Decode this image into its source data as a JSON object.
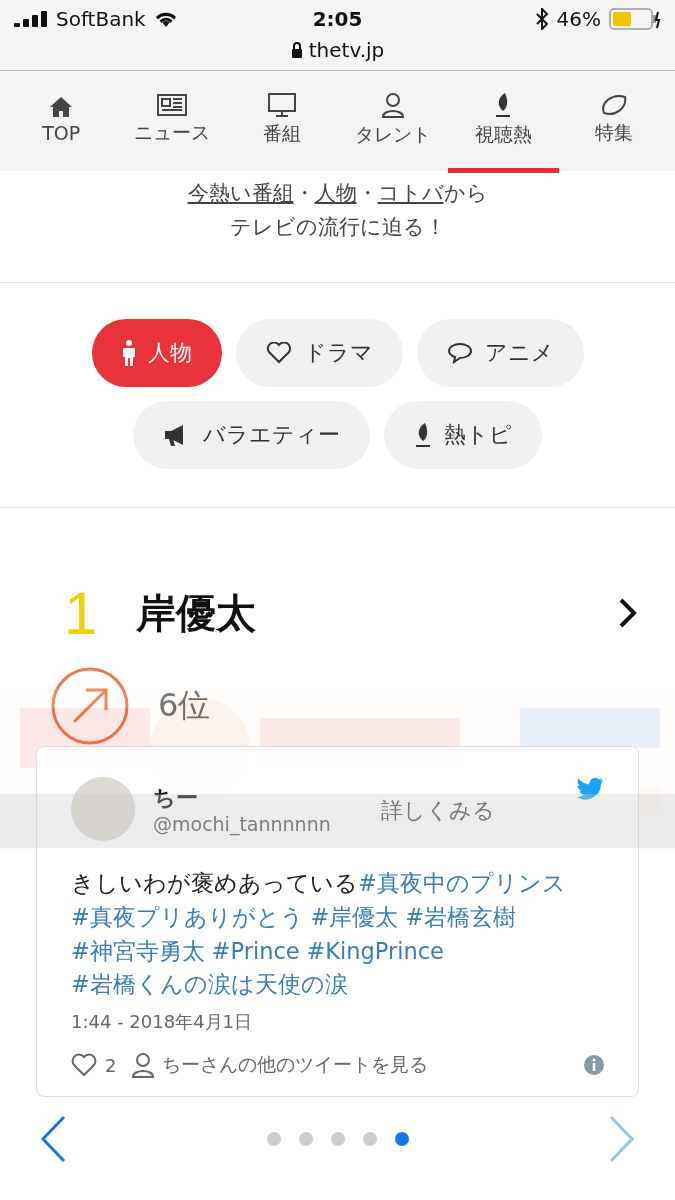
{
  "status_bar": {
    "carrier": "SoftBank",
    "time": "2:05",
    "battery": "46%",
    "url": "thetv.jp"
  },
  "nav": [
    {
      "label": "TOP",
      "selected": false
    },
    {
      "label": "ニュース",
      "selected": false
    },
    {
      "label": "番組",
      "selected": false
    },
    {
      "label": "タレント",
      "selected": false
    },
    {
      "label": "視聴熱",
      "selected": true
    },
    {
      "label": "特集",
      "selected": false
    }
  ],
  "intro": {
    "line_1": [
      {
        "kind": "link",
        "text": "今熱い番組"
      },
      {
        "kind": "text",
        "text": "・"
      },
      {
        "kind": "link",
        "text": "人物"
      },
      {
        "kind": "text",
        "text": "・"
      },
      {
        "kind": "link",
        "text": "コトバ"
      },
      {
        "kind": "text",
        "text": "から"
      }
    ],
    "line_2": "テレビの流行に迫る！"
  },
  "categories": [
    {
      "label": "人物",
      "selected": true
    },
    {
      "label": "ドラマ",
      "selected": false
    },
    {
      "label": "アニメ",
      "selected": false
    },
    {
      "label": "バラエティー",
      "selected": false
    },
    {
      "label": "熱トピ",
      "selected": false
    }
  ],
  "ranking": {
    "rank": "1",
    "name": "岸優太",
    "previous": "6位"
  },
  "ad": {
    "kind": "picture",
    "button_label": "詳しくみる"
  },
  "tweet": {
    "name": "ちー",
    "handle": "@mochi_tannnnnn",
    "text": [
      {
        "kind": "text",
        "text": "きしいわが褒めあっている"
      },
      {
        "kind": "hashtag",
        "text": "#真夜中のプリンス"
      },
      {
        "kind": "hashtag",
        "text": "#真夜プリありがとう"
      },
      {
        "kind": "hashtag",
        "text": "#岸優太"
      },
      {
        "kind": "hashtag",
        "text": "#岩橋玄樹"
      },
      {
        "kind": "hashtag",
        "text": "#神宮寺勇太"
      },
      {
        "kind": "hashtag",
        "text": "#Prince"
      },
      {
        "kind": "hashtag",
        "text": "#KingPrince"
      },
      {
        "kind": "hashtag",
        "text": "#岩橋くんの涙は天使の涙"
      }
    ],
    "timestamp": "1:44 - 2018年4月1日",
    "likes": "2",
    "more_link": "ちーさんの他のツイートを見る"
  },
  "pager": [
    {
      "selected": false
    },
    {
      "selected": false
    },
    {
      "selected": false
    },
    {
      "selected": false
    },
    {
      "selected": true
    }
  ]
}
